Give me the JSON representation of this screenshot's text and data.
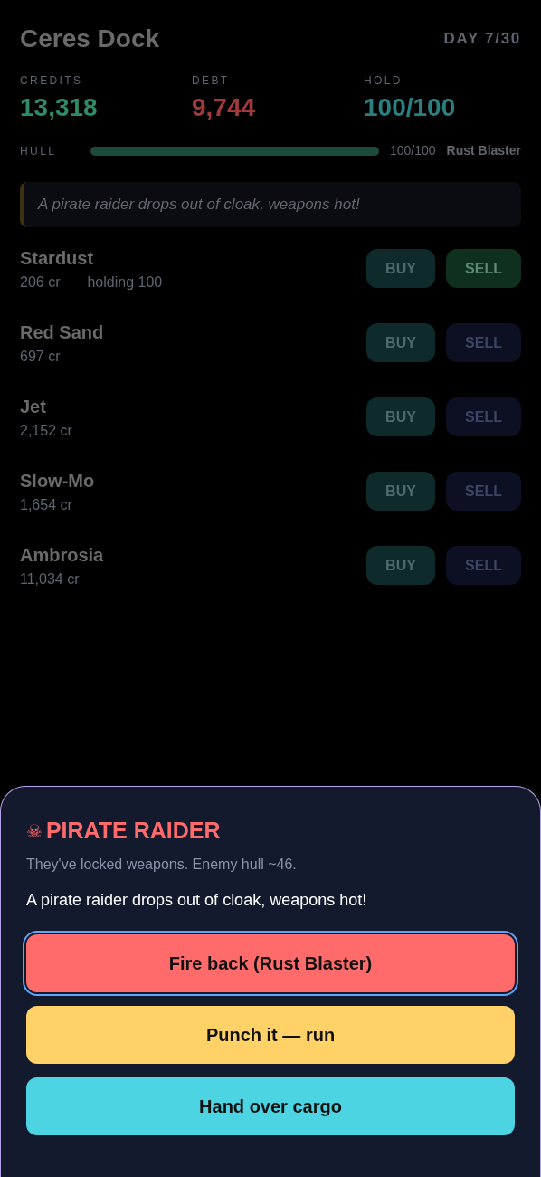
{
  "header": {
    "title": "Ceres Dock",
    "day": "DAY 7/30"
  },
  "stats": [
    {
      "label": "CREDITS",
      "value": "13,318",
      "kind": "credits"
    },
    {
      "label": "DEBT",
      "value": "9,744",
      "kind": "debt"
    },
    {
      "label": "HOLD",
      "value": "100/100",
      "kind": "hold"
    }
  ],
  "hull": {
    "label": "HULL",
    "level": 1,
    "reading": "100/100",
    "weapon": "Rust Blaster"
  },
  "event_log": "A pirate raider drops out of cloak, weapons hot!",
  "goods": [
    {
      "name": "Stardust",
      "price": "206 cr",
      "holding": "holding 100",
      "buy": "BUY",
      "sell": "SELL",
      "sell_disabled": false
    },
    {
      "name": "Red Sand",
      "price": "697 cr",
      "buy": "BUY",
      "sell": "SELL",
      "sell_disabled": true
    },
    {
      "name": "Jet",
      "price": "2,152 cr",
      "buy": "BUY",
      "sell": "SELL",
      "sell_disabled": true
    },
    {
      "name": "Slow-Mo",
      "price": "1,654 cr",
      "buy": "BUY",
      "sell": "SELL",
      "sell_disabled": true
    },
    {
      "name": "Ambrosia",
      "price": "11,034 cr",
      "buy": "BUY",
      "sell": "SELL",
      "sell_disabled": true
    }
  ],
  "dialog": {
    "icon": "☠",
    "title": "PIRATE RAIDER",
    "subtitle": "They've locked weapons. Enemy hull ~46.",
    "message": "A pirate raider drops out of cloak, weapons hot!",
    "actions": [
      {
        "label": "Fire back (Rust Blaster)",
        "kind": "fight",
        "focused": true
      },
      {
        "label": "Punch it — run",
        "kind": "flee",
        "focused": false
      },
      {
        "label": "Hand over cargo",
        "kind": "surrender",
        "focused": false
      }
    ]
  }
}
